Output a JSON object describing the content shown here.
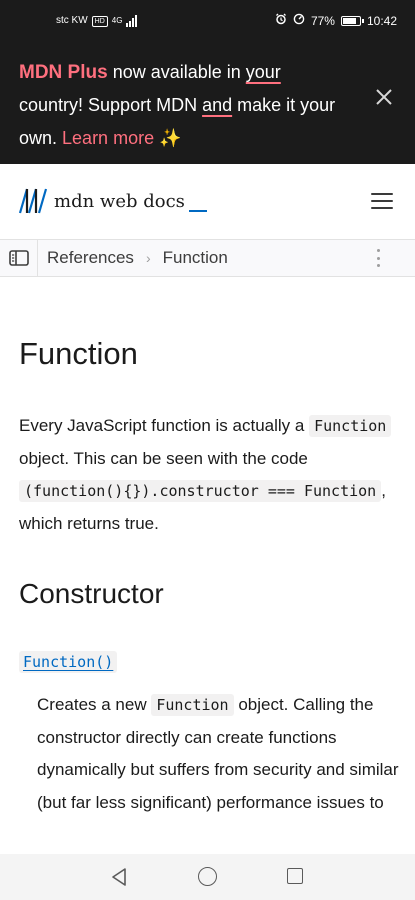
{
  "status_bar": {
    "carrier": "stc KW",
    "network_badge": "HD",
    "network_type": "4G",
    "battery": "77%",
    "time": "10:42",
    "icons": [
      "alarm-icon",
      "speed-icon",
      "battery-icon"
    ]
  },
  "promo": {
    "brand": "MDN Plus",
    "text_1": " now available in ",
    "link_your": "your",
    "text_2": " country! Support MDN ",
    "link_and": "and",
    "text_3": " make it your own. ",
    "learn_more": "Learn more",
    "sparkle": "✨",
    "accent_color": "#ff707f"
  },
  "header": {
    "logo_text": "mdn web docs",
    "logo_color": "#0069c2",
    "menu_icon": "hamburger-icon"
  },
  "breadcrumb": {
    "items": [
      "References",
      "Function"
    ],
    "separator": "›"
  },
  "article": {
    "title": "Function",
    "intro": {
      "t1": "Every JavaScript function is actually a ",
      "c1": "Function",
      "t2": " object. This can be seen with the code ",
      "c2": "(function(){}).constructor === Function",
      "t3": ", which returns true."
    },
    "constructor_heading": "Constructor",
    "constructor_link": "Function()",
    "constructor_desc": {
      "t1": "Creates a new ",
      "c1": "Function",
      "t2": " object. Calling the constructor directly can create functions dynamically but suffers from security and similar (but far less significant) performance issues to"
    }
  },
  "nav_bar": {
    "buttons": [
      "back-icon",
      "home-icon",
      "recents-icon"
    ]
  }
}
